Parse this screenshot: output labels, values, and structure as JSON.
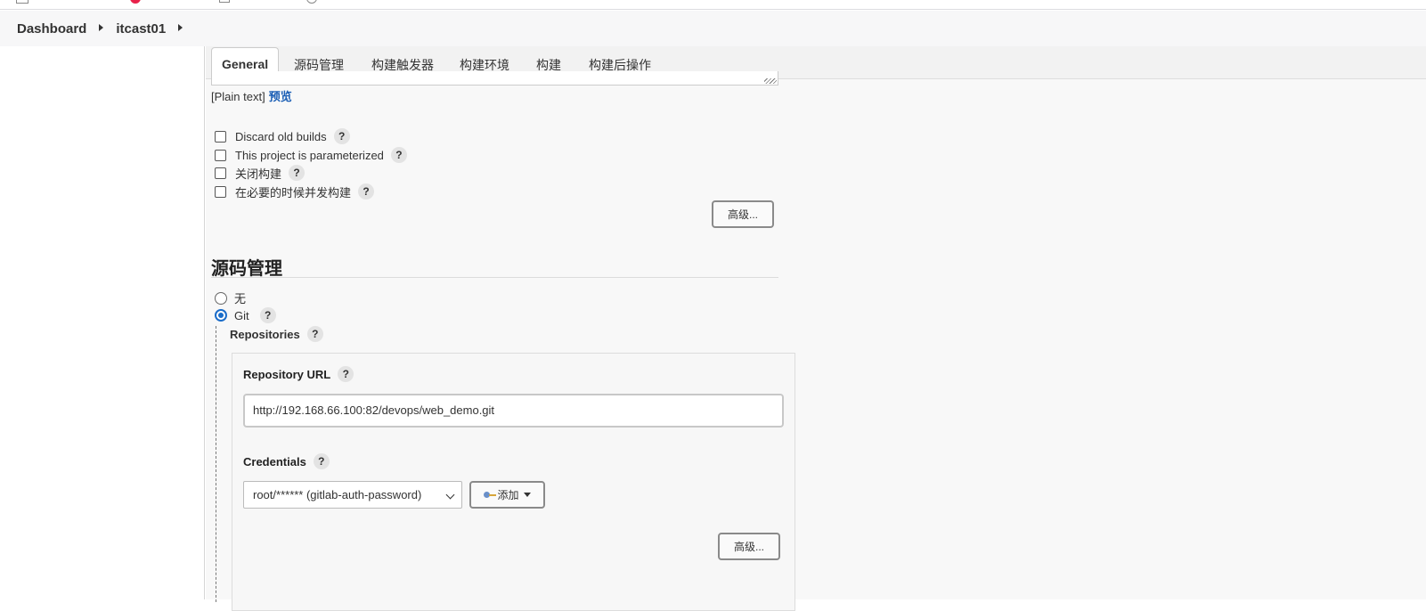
{
  "breadcrumb": {
    "items": [
      "Dashboard",
      "itcast01"
    ]
  },
  "tabs": [
    {
      "label": "General",
      "active": true
    },
    {
      "label": "源码管理",
      "active": false
    },
    {
      "label": "构建触发器",
      "active": false
    },
    {
      "label": "构建环境",
      "active": false
    },
    {
      "label": "构建",
      "active": false
    },
    {
      "label": "构建后操作",
      "active": false
    }
  ],
  "description": {
    "plain_text": "[Plain text]",
    "preview_link": "预览"
  },
  "general_options": [
    {
      "label": "Discard old builds",
      "checked": false
    },
    {
      "label": "This project is parameterized",
      "checked": false
    },
    {
      "label": "关闭构建",
      "checked": false
    },
    {
      "label": "在必要的时候并发构建",
      "checked": false
    }
  ],
  "help_glyph": "?",
  "advanced_label": "高级...",
  "scm": {
    "title": "源码管理",
    "options": [
      {
        "label": "无",
        "selected": false
      },
      {
        "label": "Git",
        "selected": true
      }
    ],
    "repositories_label": "Repositories",
    "repo_url_label": "Repository URL",
    "repo_url_value": "http://192.168.66.100:82/devops/web_demo.git",
    "credentials_label": "Credentials",
    "credentials_value": "root/****** (gitlab-auth-password)",
    "add_label": "添加"
  },
  "colors": {
    "accent": "#1a6cc9",
    "link": "#1a5eb5"
  }
}
